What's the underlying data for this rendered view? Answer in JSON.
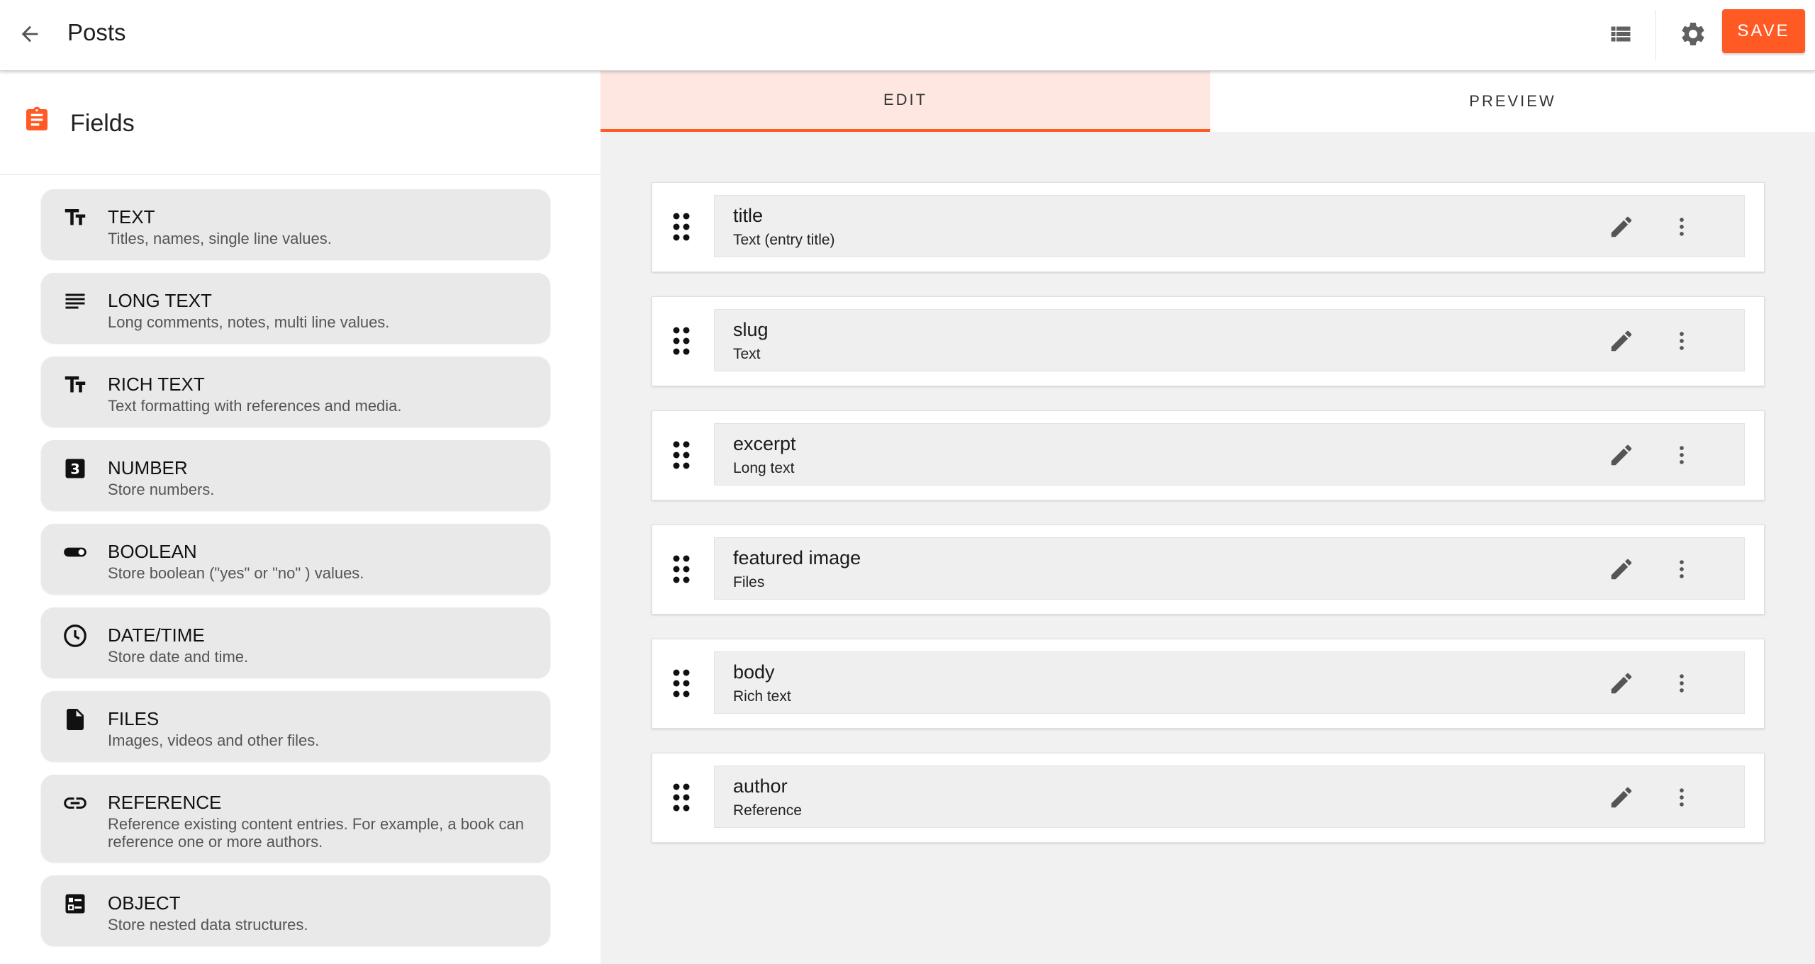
{
  "appbar": {
    "title": "Posts",
    "back_icon": "arrow-back-icon",
    "list_icon": "view-list-icon",
    "settings_icon": "gear-icon",
    "save_label": "SAVE",
    "accent_color": "#ff5a24"
  },
  "sidebar": {
    "title": "Fields",
    "title_icon": "clipboard-icon",
    "field_types": [
      {
        "name": "TEXT",
        "description": "Titles, names, single line values.",
        "icon": "text-format-icon"
      },
      {
        "name": "LONG TEXT",
        "description": "Long comments, notes, multi line values.",
        "icon": "lines-icon"
      },
      {
        "name": "RICH TEXT",
        "description": "Text formatting with references and media.",
        "icon": "text-format-icon"
      },
      {
        "name": "NUMBER",
        "description": "Store numbers.",
        "icon": "number-three-icon"
      },
      {
        "name": "BOOLEAN",
        "description": "Store boolean (\"yes\" or \"no\" ) values.",
        "icon": "toggle-icon"
      },
      {
        "name": "DATE/TIME",
        "description": "Store date and time.",
        "icon": "clock-icon"
      },
      {
        "name": "FILES",
        "description": "Images, videos and other files.",
        "icon": "file-icon"
      },
      {
        "name": "REFERENCE",
        "description": "Reference existing content entries. For example, a book can reference one or more authors.",
        "icon": "link-icon"
      },
      {
        "name": "OBJECT",
        "description": "Store nested data structures.",
        "icon": "object-list-icon"
      }
    ]
  },
  "main": {
    "tabs": [
      {
        "label": "EDIT",
        "active": true
      },
      {
        "label": "PREVIEW",
        "active": false
      }
    ],
    "fields": [
      {
        "name": "title",
        "type": "Text (entry title)"
      },
      {
        "name": "slug",
        "type": "Text"
      },
      {
        "name": "excerpt",
        "type": "Long text"
      },
      {
        "name": "featured image",
        "type": "Files"
      },
      {
        "name": "body",
        "type": "Rich text"
      },
      {
        "name": "author",
        "type": "Reference"
      }
    ]
  }
}
